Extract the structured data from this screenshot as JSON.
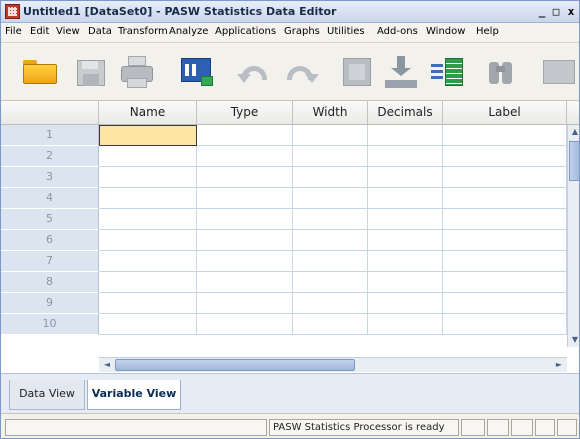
{
  "window": {
    "title": "Untitled1 [DataSet0] - PASW Statistics Data Editor",
    "controls": {
      "minimize": "_",
      "maximize": "□",
      "close": "x"
    }
  },
  "menu": {
    "items": [
      "File",
      "Edit",
      "View",
      "Data",
      "Transform",
      "Analyze",
      "Applications",
      "Graphs",
      "Utilities",
      "Add-ons",
      "Window",
      "Help"
    ]
  },
  "toolbar": {
    "buttons": [
      {
        "icon": "open-folder-icon"
      },
      {
        "icon": "save-disk-icon"
      },
      {
        "icon": "print-icon"
      },
      {
        "icon": "recall-dialog-icon"
      },
      {
        "icon": "undo-icon"
      },
      {
        "icon": "redo-icon"
      },
      {
        "icon": "go-to-case-icon"
      },
      {
        "icon": "go-to-variable-icon"
      },
      {
        "icon": "variables-icon"
      },
      {
        "icon": "find-binoculars-icon"
      },
      {
        "icon": "insert-cases-icon"
      }
    ]
  },
  "grid": {
    "columns": [
      "",
      "Name",
      "Type",
      "Width",
      "Decimals",
      "Label"
    ],
    "rows": [
      "1",
      "2",
      "3",
      "4",
      "5",
      "6",
      "7",
      "8",
      "9",
      "10"
    ],
    "active_cell": {
      "row": "1",
      "column": "Name"
    }
  },
  "tabs": {
    "data_view": "Data View",
    "variable_view": "Variable View",
    "active": "Variable View"
  },
  "status": {
    "message": "PASW Statistics Processor is ready"
  },
  "colors": {
    "title_text": "#1a2b48",
    "row_header_bg": "#dce4ef",
    "active_cell_bg": "#fde5a6",
    "grid_line": "#c7d4e4"
  }
}
